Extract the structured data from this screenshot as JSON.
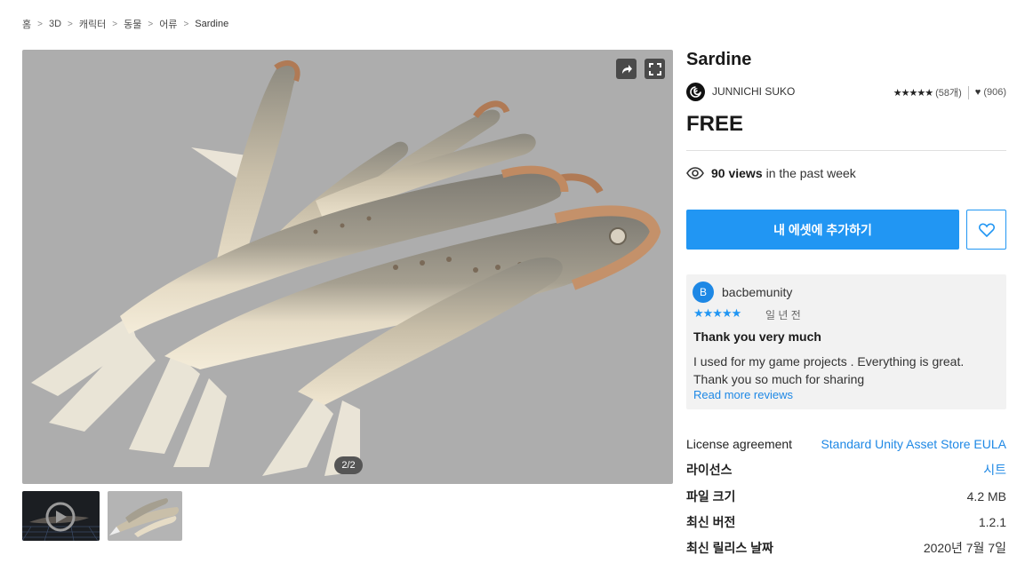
{
  "breadcrumb": [
    "홈",
    "3D",
    "캐릭터",
    "동물",
    "어류",
    "Sardine"
  ],
  "viewer": {
    "counter": "2/2",
    "share_icon": "share-icon",
    "fullscreen_icon": "fullscreen-icon"
  },
  "product": {
    "title": "Sardine",
    "publisher": "JUNNICHI SUKO",
    "stars": "★★★★★",
    "rating_count": "(58개)",
    "favorites": "(906)",
    "price": "FREE",
    "views_count": "90 views",
    "views_suffix": "in the past week",
    "add_button": "내 에셋에 추가하기"
  },
  "review": {
    "avatar_letter": "B",
    "user": "bacbemunity",
    "stars": "★★★★★",
    "time": "일 년 전",
    "title": "Thank you very much",
    "body": "I used for my game projects . Everything is great. Thank you so much for sharing",
    "read_more": "Read more reviews"
  },
  "specs": [
    {
      "label": "License agreement",
      "value": "Standard Unity Asset Store EULA"
    },
    {
      "label": "라이선스",
      "value": "시트"
    },
    {
      "label": "파일 크기",
      "value": "4.2 MB"
    },
    {
      "label": "최신 버전",
      "value": "1.2.1"
    },
    {
      "label": "최신 릴리스 날짜",
      "value": "2020년 7월 7일"
    }
  ],
  "colors": {
    "accent": "#2196f3",
    "viewer_bg": "#adadad"
  }
}
